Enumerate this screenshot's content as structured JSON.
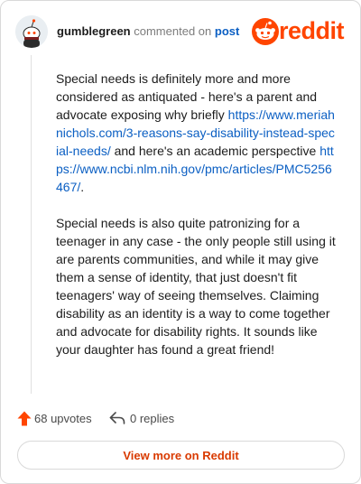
{
  "colors": {
    "brand": "#ff4500",
    "link": "#0b5fc3",
    "cta": "#d93a00",
    "muted": "#7c7c7c"
  },
  "comment": {
    "username": "gumblegreen",
    "action_text": "commented on",
    "target_label": "post",
    "paragraph1_text": "Special needs is definitely more and more considered as antiquated - here's a parent and advocate exposing why briefly ",
    "paragraph1_link1": "https://www.meriahnichols.com/3-reasons-say-disability-instead-special-needs/",
    "paragraph1_mid": " and here's an academic perspective ",
    "paragraph1_link2": "https://www.ncbi.nlm.nih.gov/pmc/articles/PMC5256467/",
    "paragraph1_end": ".",
    "paragraph2": "Special needs is also quite patronizing for a teenager in any case - the only people still using it are parents communities, and while it may give them a sense of identity, that just doesn't fit teenagers' way of seeing themselves. Claiming disability as an identity is a way to come together and advocate for disability rights. It sounds like your daughter has found a great friend!"
  },
  "logo": {
    "wordmark": "reddit",
    "icon": "reddit-snoo-icon"
  },
  "footer": {
    "upvotes_label": "68 upvotes",
    "upvote_icon": "upvote-arrow-icon",
    "replies_label": "0 replies",
    "reply_icon": "reply-arrow-icon"
  },
  "cta": {
    "label": "View more on Reddit"
  }
}
